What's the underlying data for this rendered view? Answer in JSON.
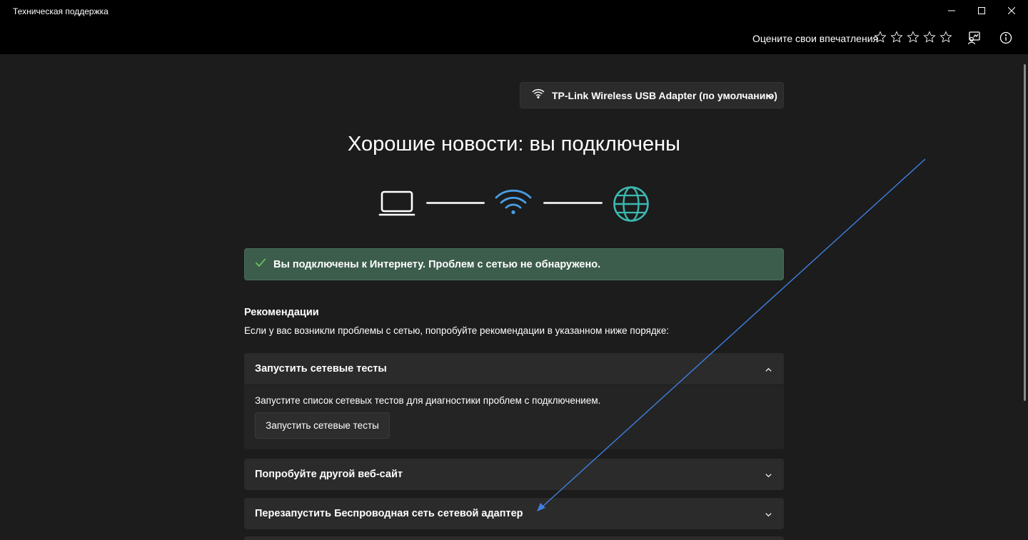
{
  "window": {
    "title": "Техническая поддержка"
  },
  "header": {
    "rate_label": "Оцените свои впечатления",
    "star_count": 5,
    "feedback_icon": "feedback-icon",
    "info_icon": "info-icon"
  },
  "adapter": {
    "label": "TP-Link Wireless USB Adapter (по умолчанию)",
    "icon": "wifi-icon"
  },
  "status": {
    "headline": "Хорошие новости: вы подключены",
    "banner_text": "Вы подключены к Интернету. Проблем с сетью не обнаружено."
  },
  "colors": {
    "accent_blue": "#4a9fe6",
    "globe_teal": "#3bb8b0",
    "success_green": "#6ccb5f",
    "banner_bg": "#3d5d4c"
  },
  "recommendations": {
    "title": "Рекомендации",
    "subtitle": "Если у вас возникли проблемы с сетью, попробуйте рекомендации в указанном ниже порядке:",
    "items": [
      {
        "label": "Запустить сетевые тесты",
        "expanded": true,
        "description": "Запустите список сетевых тестов для диагностики проблем с подключением.",
        "button_label": "Запустить сетевые тесты"
      },
      {
        "label": "Попробуйте другой веб-сайт",
        "expanded": false
      },
      {
        "label": "Перезапустить Беспроводная сеть сетевой адаптер",
        "expanded": false
      }
    ]
  }
}
